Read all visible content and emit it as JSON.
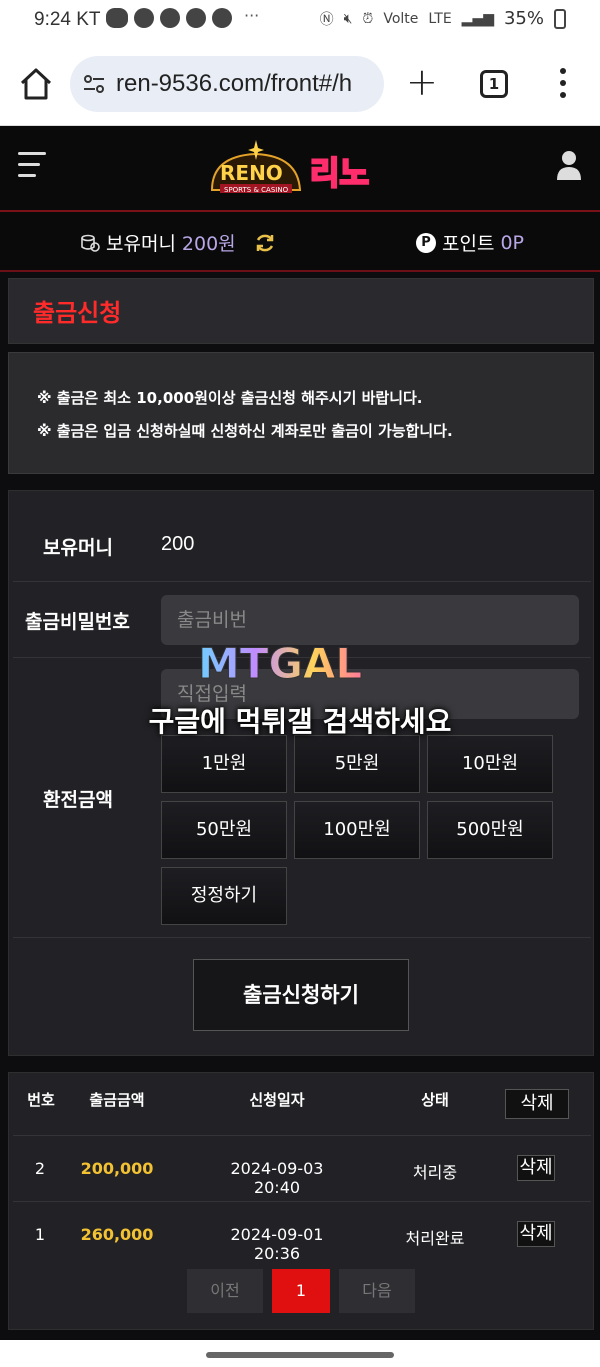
{
  "status_bar": {
    "time": "9:24 KT",
    "icons": [
      "talk-icon",
      "chrome-icon",
      "chrome-icon",
      "chrome-icon",
      "chrome-icon",
      "nfc-icon",
      "mute-icon",
      "alarm-icon",
      "volte-icon",
      "lte-icon",
      "signal-icon",
      "battery-icon"
    ],
    "more": "···",
    "volte": "Volte",
    "lte": "LTE",
    "battery": "35%"
  },
  "browser": {
    "url": "ren-9536.com/front#/h",
    "tab_count": "1"
  },
  "header": {
    "logo_text": "RENO",
    "logo_sub": "SPORTS & CASINO",
    "logo_kr": "리노"
  },
  "money_bar": {
    "money_label": "보유머니",
    "money_value": "200원",
    "point_badge": "P",
    "point_label": "포인트",
    "point_value": "0P"
  },
  "page": {
    "title": "출금신청"
  },
  "notices": [
    "※ 출금은 최소 10,000원이상 출금신청 해주시기 바랍니다.",
    "※ 출금은 입금 신청하실때 신청하신 계좌로만 출금이 가능합니다."
  ],
  "form": {
    "balance_label": "보유머니",
    "balance_value": "200",
    "password_label": "출금비밀번호",
    "password_placeholder": "출금비번",
    "amount_label": "환전금액",
    "amount_placeholder": "직접입력",
    "amount_buttons": [
      "1만원",
      "5만원",
      "10만원",
      "50만원",
      "100만원",
      "500만원"
    ],
    "reset_button": "정정하기",
    "submit_button": "출금신청하기"
  },
  "watermark": {
    "logo": "MTGAL",
    "text": "구글에 먹튀갤 검색하세요"
  },
  "history": {
    "headers": [
      "번호",
      "출금금액",
      "신청일자",
      "상태"
    ],
    "delete_all": "삭제",
    "rows": [
      {
        "no": "2",
        "amount": "200,000",
        "date": "2024-09-03 20:40",
        "status": "처리중",
        "delete": "삭제"
      },
      {
        "no": "1",
        "amount": "260,000",
        "date": "2024-09-01 20:36",
        "status": "처리완료",
        "delete": "삭제"
      }
    ],
    "pager": {
      "prev": "이전",
      "current": "1",
      "next": "다음"
    }
  },
  "colors": {
    "accent_red": "#ff2b2b",
    "amount_gold": "#f3c232",
    "money_purple": "#b8a6e6",
    "page_bg": "#0d0d0f"
  }
}
